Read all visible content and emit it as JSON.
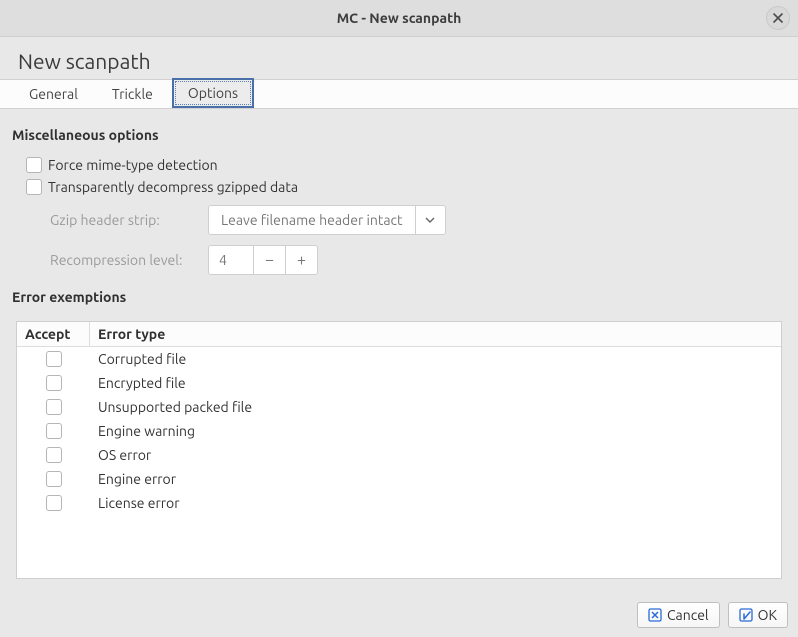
{
  "window": {
    "title": "MC - New scanpath"
  },
  "heading": "New scanpath",
  "tabs": [
    {
      "label": "General",
      "active": false
    },
    {
      "label": "Trickle",
      "active": false
    },
    {
      "label": "Options",
      "active": true
    }
  ],
  "misc": {
    "section_title": "Miscellaneous options",
    "force_mime_label": "Force mime-type detection",
    "force_mime_checked": false,
    "transp_gzip_label": "Transparently decompress gzipped data",
    "transp_gzip_checked": false,
    "gzip_strip_label": "Gzip header strip:",
    "gzip_strip_value": "Leave filename header intact",
    "recompression_label": "Recompression level:",
    "recompression_value": "4"
  },
  "error_exemptions": {
    "section_title": "Error exemptions",
    "columns": {
      "accept": "Accept",
      "error_type": "Error type"
    },
    "rows": [
      {
        "accept": false,
        "error_type": "Corrupted file"
      },
      {
        "accept": false,
        "error_type": "Encrypted file"
      },
      {
        "accept": false,
        "error_type": "Unsupported packed file"
      },
      {
        "accept": false,
        "error_type": "Engine warning"
      },
      {
        "accept": false,
        "error_type": "OS error"
      },
      {
        "accept": false,
        "error_type": "Engine error"
      },
      {
        "accept": false,
        "error_type": "License error"
      }
    ]
  },
  "footer": {
    "cancel_label": "Cancel",
    "ok_label": "OK"
  }
}
